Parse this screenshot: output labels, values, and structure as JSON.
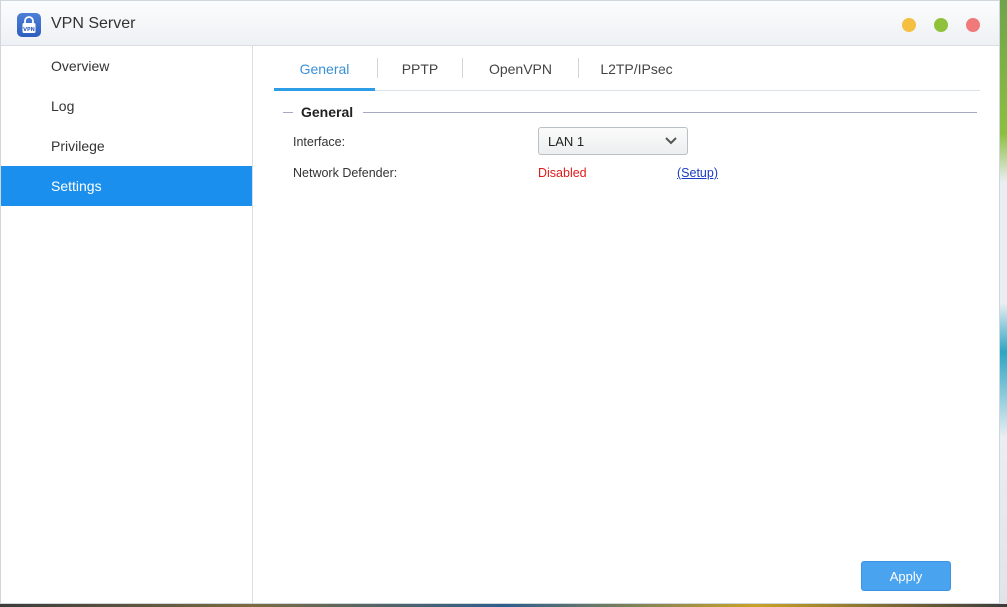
{
  "window": {
    "title": "VPN Server",
    "icon": "vpn-lock-icon",
    "icon_label": "VPN",
    "controls": [
      "minimize",
      "maximize",
      "close"
    ]
  },
  "sidebar": {
    "items": [
      {
        "label": "Overview",
        "active": false
      },
      {
        "label": "Log",
        "active": false
      },
      {
        "label": "Privilege",
        "active": false
      },
      {
        "label": "Settings",
        "active": true
      }
    ]
  },
  "tabs": [
    {
      "label": "General",
      "active": true
    },
    {
      "label": "PPTP",
      "active": false
    },
    {
      "label": "OpenVPN",
      "active": false
    },
    {
      "label": "L2TP/IPsec",
      "active": false
    }
  ],
  "general": {
    "section_title": "General",
    "interface_label": "Interface:",
    "interface_value": "LAN 1",
    "network_defender_label": "Network Defender:",
    "network_defender_status": "Disabled",
    "setup_link": "(Setup)"
  },
  "apply_label": "Apply",
  "colors": {
    "accent": "#1a8fee",
    "status_disabled": "#e01b1b",
    "link": "#1a3cc4",
    "apply": "#4aa3ef"
  }
}
